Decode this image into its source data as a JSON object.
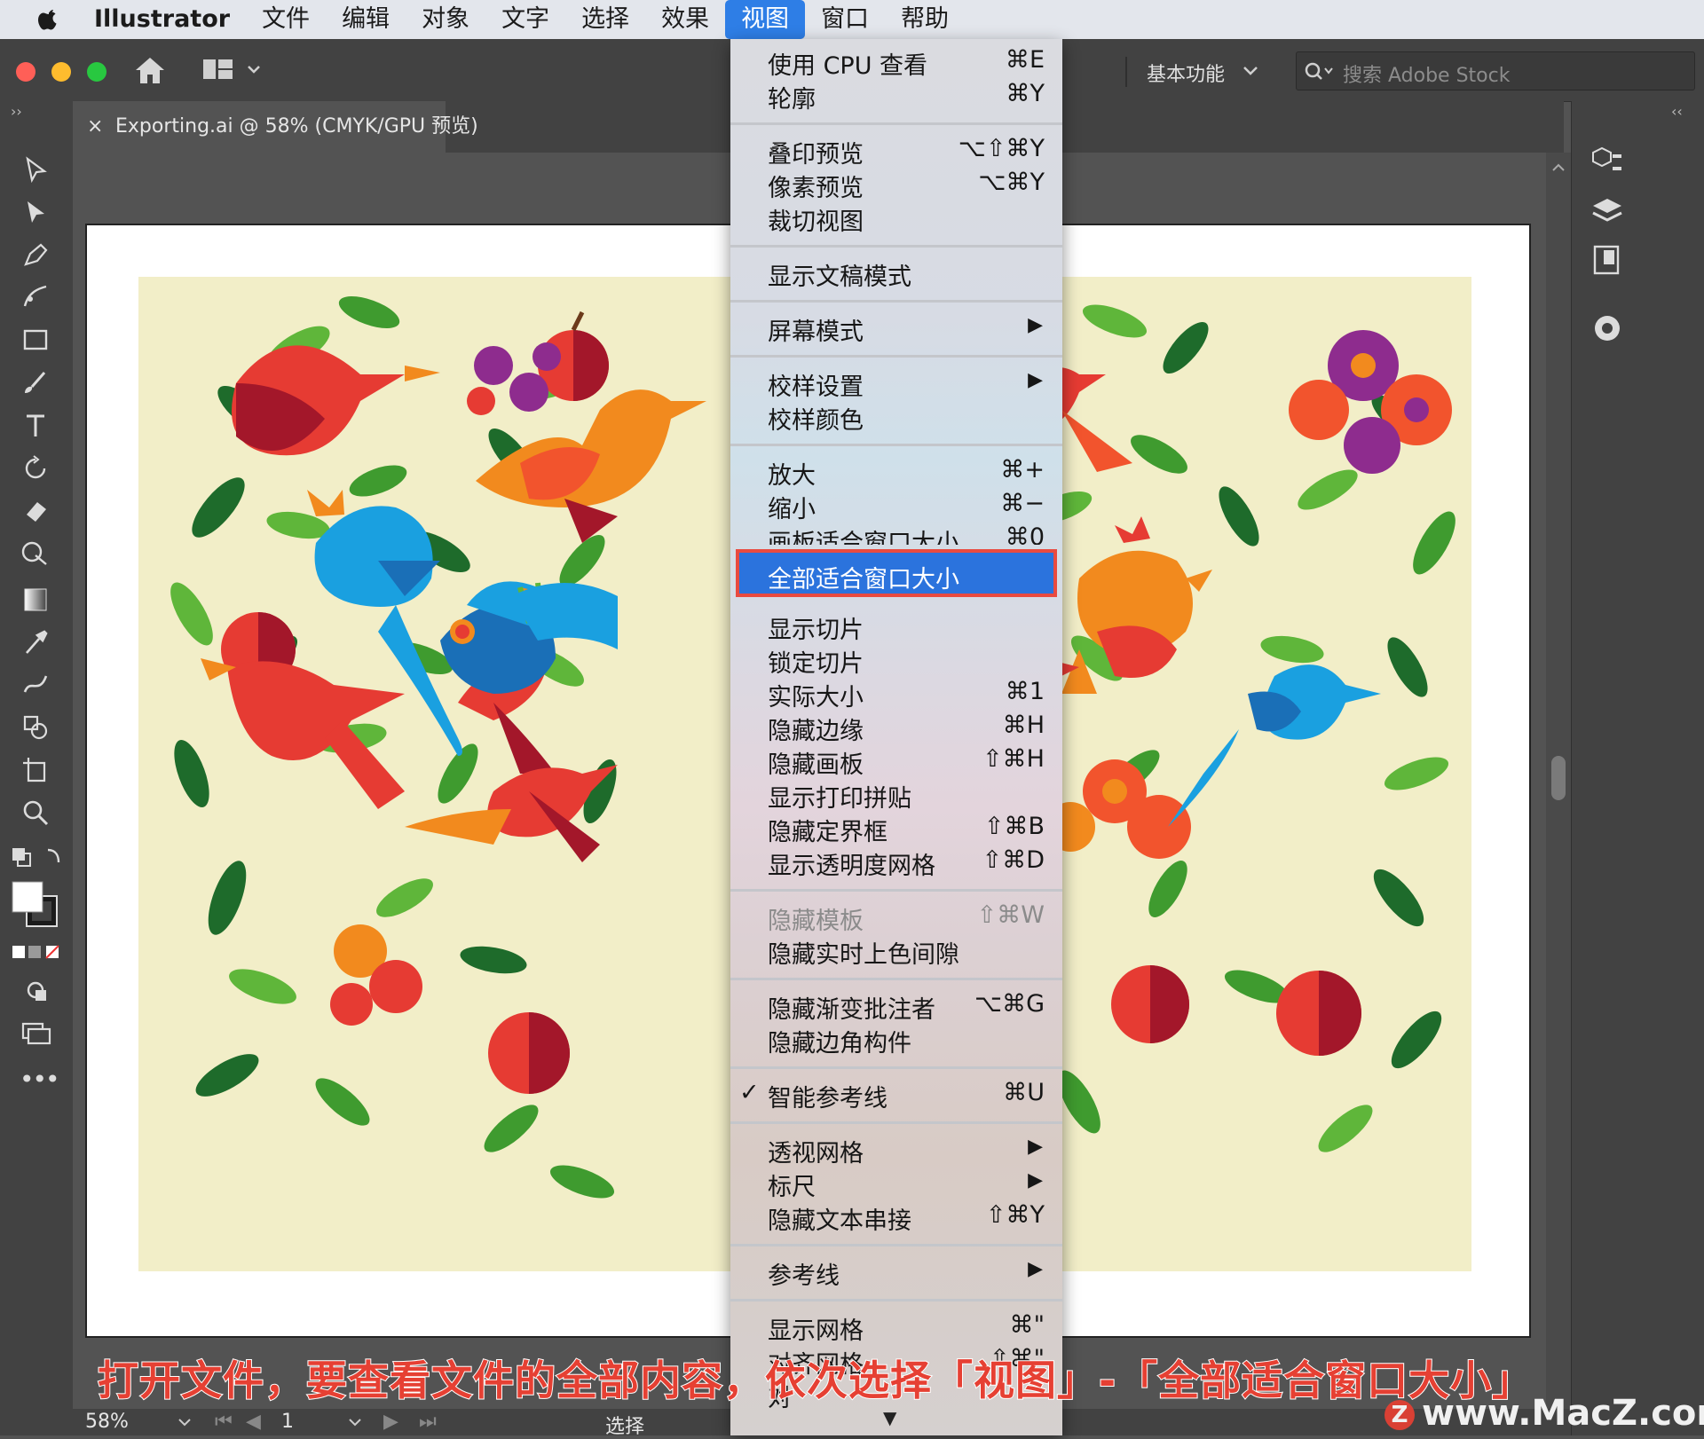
{
  "menubar": {
    "app": "Illustrator",
    "items": [
      "文件",
      "编辑",
      "对象",
      "文字",
      "选择",
      "效果",
      "视图",
      "窗口",
      "帮助"
    ],
    "active": "视图"
  },
  "appbar": {
    "workspace": "基本功能",
    "search_placeholder": "搜索 Adobe Stock"
  },
  "document": {
    "tab_title": "Exporting.ai @ 58% (CMYK/GPU 预览)",
    "tab_close": "×"
  },
  "status": {
    "zoom": "58%",
    "page": "1",
    "tool": "选择"
  },
  "view_menu": {
    "items": [
      {
        "label": "使用 CPU 查看",
        "shortcut": "⌘E"
      },
      {
        "label": "轮廓",
        "shortcut": "⌘Y"
      },
      {
        "label": "叠印预览",
        "shortcut": "⌥⇧⌘Y"
      },
      {
        "label": "像素预览",
        "shortcut": "⌥⌘Y"
      },
      {
        "label": "裁切视图",
        "shortcut": ""
      },
      {
        "label": "显示文稿模式",
        "shortcut": ""
      },
      {
        "label": "屏幕模式",
        "shortcut": "▶"
      },
      {
        "label": "校样设置",
        "shortcut": "▶"
      },
      {
        "label": "校样颜色",
        "shortcut": ""
      },
      {
        "label": "放大",
        "shortcut": "⌘+"
      },
      {
        "label": "缩小",
        "shortcut": "⌘−"
      },
      {
        "label": "画板适合窗口大小",
        "shortcut": "⌘0"
      },
      {
        "label": "全部适合窗口大小",
        "shortcut": ""
      },
      {
        "label": "显示切片",
        "shortcut": ""
      },
      {
        "label": "锁定切片",
        "shortcut": ""
      },
      {
        "label": "实际大小",
        "shortcut": "⌘1"
      },
      {
        "label": "隐藏边缘",
        "shortcut": "⌘H"
      },
      {
        "label": "隐藏画板",
        "shortcut": "⇧⌘H"
      },
      {
        "label": "显示打印拼贴",
        "shortcut": ""
      },
      {
        "label": "隐藏定界框",
        "shortcut": "⇧⌘B"
      },
      {
        "label": "显示透明度网格",
        "shortcut": "⇧⌘D"
      },
      {
        "label": "隐藏模板",
        "shortcut": "⇧⌘W"
      },
      {
        "label": "隐藏实时上色间隙",
        "shortcut": ""
      },
      {
        "label": "隐藏渐变批注者",
        "shortcut": "⌥⌘G"
      },
      {
        "label": "隐藏边角构件",
        "shortcut": ""
      },
      {
        "label": "智能参考线",
        "shortcut": "⌘U",
        "check": "✓"
      },
      {
        "label": "透视网格",
        "shortcut": "▶"
      },
      {
        "label": "标尺",
        "shortcut": "▶"
      },
      {
        "label": "隐藏文本串接",
        "shortcut": "⇧⌘Y"
      },
      {
        "label": "参考线",
        "shortcut": "▶"
      },
      {
        "label": "显示网格",
        "shortcut": "⌘\""
      },
      {
        "label": "对齐网格",
        "shortcut": "⇧⌘\""
      },
      {
        "label": "对",
        "shortcut": ""
      }
    ],
    "more": "▼"
  },
  "caption": "打开文件，要查看文件的全部内容，依次选择「视图」-「全部适合窗口大小」",
  "watermark": "www.MacZ.com",
  "colors": {
    "highlight": "#2b73dd",
    "highlight_border": "#e94a3f",
    "art_bg": "#f2eec8",
    "red": "#e63b33",
    "orange": "#f28a1e",
    "blue": "#1aa0e0",
    "green": "#2e8b2e",
    "purple": "#8e2c8e"
  }
}
